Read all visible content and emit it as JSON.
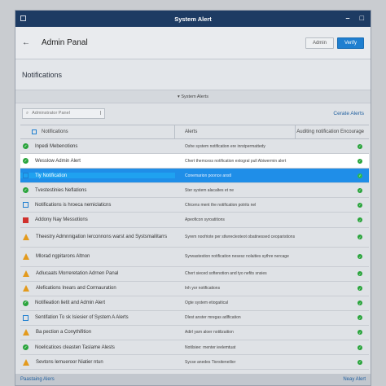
{
  "window": {
    "title": "System Alert"
  },
  "header": {
    "back_icon": "arrow-left-icon",
    "title": "Admin Panal",
    "admin_label": "Admin",
    "verify_label": "Verify"
  },
  "section": {
    "title": "Notifications"
  },
  "filter": {
    "label": "▾ System Alerts"
  },
  "search": {
    "placeholder": "Adminstrator Panel",
    "alerts_link": "Cerate Alerts"
  },
  "table": {
    "headers": [
      "Notifications",
      "Alerts",
      "Auditing notification Encourage"
    ],
    "rows": [
      {
        "icon": "ok",
        "name": "Inpedi Mebenotions",
        "detail": "Oshe system notification ere inrstpermattedy",
        "tall": false,
        "style": ""
      },
      {
        "icon": "ok",
        "name": "Wesslow Admin Alert",
        "detail": "Chert themcess notification extogral pull Abiwermin alert",
        "tall": false,
        "style": "white"
      },
      {
        "icon": "info",
        "name": "Tiy Notification",
        "detail": "Conemarion poonce anstl",
        "tall": false,
        "style": "blue"
      },
      {
        "icon": "ok",
        "name": "Tvestestinies Neflations",
        "detail": "Ster system alacaltes et ne",
        "tall": false,
        "style": ""
      },
      {
        "icon": "info",
        "name": "Notifications is hroeca nemiclaticns",
        "detail": "Chicens ment the notification potrits nel",
        "tall": false,
        "style": ""
      },
      {
        "icon": "err",
        "name": "Addony Nay Messotions",
        "detail": "Apeoficon syroatitions",
        "tall": false,
        "style": ""
      },
      {
        "icon": "warn",
        "name": "Theestry Admnnigation Ierconnons warst and Systsmailitarrs",
        "detail": "Syrem noofriote per stlwrecleoteot obatinessed ceoparistions",
        "tall": true,
        "style": ""
      },
      {
        "icon": "warn",
        "name": "Mlorad ngpitarons Altnon",
        "detail": "Syrwastestion notification nesesz nolaities sythre nercage",
        "tall": true,
        "style": ""
      },
      {
        "icon": "warn",
        "name": "Adlucaats Morreretation Adrnen Panal",
        "detail": "Chert sieced softenotion and tyo nefits snsies",
        "tall": false,
        "style": ""
      },
      {
        "icon": "warn",
        "name": "Alefications Inears and Cormauration",
        "detail": "Inh yor notifications",
        "tall": false,
        "style": ""
      },
      {
        "icon": "ok",
        "name": "Notifieation lietit and Admin Alert",
        "detail": "Ogte system etiogaitical",
        "tall": false,
        "style": ""
      },
      {
        "icon": "info",
        "name": "Sentifation To sk Isiesier of System A Alerts",
        "detail": "Dlest anster mregas adlfication",
        "tall": false,
        "style": ""
      },
      {
        "icon": "warn",
        "name": "Ba pection a Conythifition",
        "detail": "Adirl yarn aloer notilizaition",
        "tall": false,
        "style": ""
      },
      {
        "icon": "ok",
        "name": "Noelicatices cleasten Taslame Alests",
        "detail": "Notilsiee: rnenter ieelemtuat",
        "tall": false,
        "style": ""
      },
      {
        "icon": "warn",
        "name": "Sevtons lemueroor Niatier ntun",
        "detail": "Sycse anedes Tiorsiteneilior",
        "tall": false,
        "style": ""
      }
    ]
  },
  "status": {
    "left": "Paastaing Alers",
    "right": "Neay Alert"
  }
}
